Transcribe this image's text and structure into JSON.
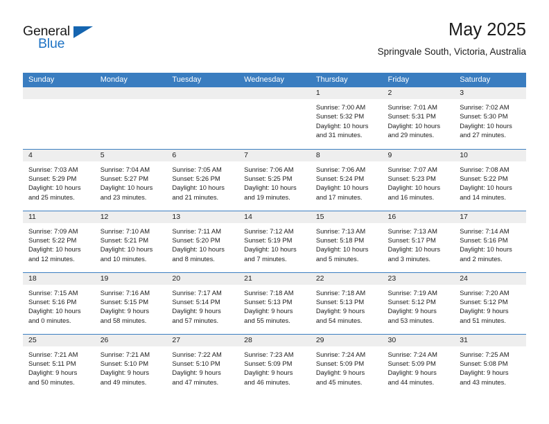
{
  "brand": {
    "word_one": "General",
    "word_two": "Blue",
    "logo_icon": "triangle-logo-icon"
  },
  "header": {
    "title": "May 2025",
    "subtitle": "Springvale South, Victoria, Australia"
  },
  "colors": {
    "header_blue": "#3a7dc0",
    "brand_blue": "#1e73c4",
    "daynum_strip": "#eeeeee",
    "text": "#1b1b1b"
  },
  "weekday_headers": [
    "Sunday",
    "Monday",
    "Tuesday",
    "Wednesday",
    "Thursday",
    "Friday",
    "Saturday"
  ],
  "weeks": [
    [
      {
        "day": "",
        "empty": true
      },
      {
        "day": "",
        "empty": true
      },
      {
        "day": "",
        "empty": true
      },
      {
        "day": "",
        "empty": true
      },
      {
        "day": "1",
        "sunrise": "Sunrise: 7:00 AM",
        "sunset": "Sunset: 5:32 PM",
        "daylight_line1": "Daylight: 10 hours",
        "daylight_line2": "and 31 minutes."
      },
      {
        "day": "2",
        "sunrise": "Sunrise: 7:01 AM",
        "sunset": "Sunset: 5:31 PM",
        "daylight_line1": "Daylight: 10 hours",
        "daylight_line2": "and 29 minutes."
      },
      {
        "day": "3",
        "sunrise": "Sunrise: 7:02 AM",
        "sunset": "Sunset: 5:30 PM",
        "daylight_line1": "Daylight: 10 hours",
        "daylight_line2": "and 27 minutes."
      }
    ],
    [
      {
        "day": "4",
        "sunrise": "Sunrise: 7:03 AM",
        "sunset": "Sunset: 5:29 PM",
        "daylight_line1": "Daylight: 10 hours",
        "daylight_line2": "and 25 minutes."
      },
      {
        "day": "5",
        "sunrise": "Sunrise: 7:04 AM",
        "sunset": "Sunset: 5:27 PM",
        "daylight_line1": "Daylight: 10 hours",
        "daylight_line2": "and 23 minutes."
      },
      {
        "day": "6",
        "sunrise": "Sunrise: 7:05 AM",
        "sunset": "Sunset: 5:26 PM",
        "daylight_line1": "Daylight: 10 hours",
        "daylight_line2": "and 21 minutes."
      },
      {
        "day": "7",
        "sunrise": "Sunrise: 7:06 AM",
        "sunset": "Sunset: 5:25 PM",
        "daylight_line1": "Daylight: 10 hours",
        "daylight_line2": "and 19 minutes."
      },
      {
        "day": "8",
        "sunrise": "Sunrise: 7:06 AM",
        "sunset": "Sunset: 5:24 PM",
        "daylight_line1": "Daylight: 10 hours",
        "daylight_line2": "and 17 minutes."
      },
      {
        "day": "9",
        "sunrise": "Sunrise: 7:07 AM",
        "sunset": "Sunset: 5:23 PM",
        "daylight_line1": "Daylight: 10 hours",
        "daylight_line2": "and 16 minutes."
      },
      {
        "day": "10",
        "sunrise": "Sunrise: 7:08 AM",
        "sunset": "Sunset: 5:22 PM",
        "daylight_line1": "Daylight: 10 hours",
        "daylight_line2": "and 14 minutes."
      }
    ],
    [
      {
        "day": "11",
        "sunrise": "Sunrise: 7:09 AM",
        "sunset": "Sunset: 5:22 PM",
        "daylight_line1": "Daylight: 10 hours",
        "daylight_line2": "and 12 minutes."
      },
      {
        "day": "12",
        "sunrise": "Sunrise: 7:10 AM",
        "sunset": "Sunset: 5:21 PM",
        "daylight_line1": "Daylight: 10 hours",
        "daylight_line2": "and 10 minutes."
      },
      {
        "day": "13",
        "sunrise": "Sunrise: 7:11 AM",
        "sunset": "Sunset: 5:20 PM",
        "daylight_line1": "Daylight: 10 hours",
        "daylight_line2": "and 8 minutes."
      },
      {
        "day": "14",
        "sunrise": "Sunrise: 7:12 AM",
        "sunset": "Sunset: 5:19 PM",
        "daylight_line1": "Daylight: 10 hours",
        "daylight_line2": "and 7 minutes."
      },
      {
        "day": "15",
        "sunrise": "Sunrise: 7:13 AM",
        "sunset": "Sunset: 5:18 PM",
        "daylight_line1": "Daylight: 10 hours",
        "daylight_line2": "and 5 minutes."
      },
      {
        "day": "16",
        "sunrise": "Sunrise: 7:13 AM",
        "sunset": "Sunset: 5:17 PM",
        "daylight_line1": "Daylight: 10 hours",
        "daylight_line2": "and 3 minutes."
      },
      {
        "day": "17",
        "sunrise": "Sunrise: 7:14 AM",
        "sunset": "Sunset: 5:16 PM",
        "daylight_line1": "Daylight: 10 hours",
        "daylight_line2": "and 2 minutes."
      }
    ],
    [
      {
        "day": "18",
        "sunrise": "Sunrise: 7:15 AM",
        "sunset": "Sunset: 5:16 PM",
        "daylight_line1": "Daylight: 10 hours",
        "daylight_line2": "and 0 minutes."
      },
      {
        "day": "19",
        "sunrise": "Sunrise: 7:16 AM",
        "sunset": "Sunset: 5:15 PM",
        "daylight_line1": "Daylight: 9 hours",
        "daylight_line2": "and 58 minutes."
      },
      {
        "day": "20",
        "sunrise": "Sunrise: 7:17 AM",
        "sunset": "Sunset: 5:14 PM",
        "daylight_line1": "Daylight: 9 hours",
        "daylight_line2": "and 57 minutes."
      },
      {
        "day": "21",
        "sunrise": "Sunrise: 7:18 AM",
        "sunset": "Sunset: 5:13 PM",
        "daylight_line1": "Daylight: 9 hours",
        "daylight_line2": "and 55 minutes."
      },
      {
        "day": "22",
        "sunrise": "Sunrise: 7:18 AM",
        "sunset": "Sunset: 5:13 PM",
        "daylight_line1": "Daylight: 9 hours",
        "daylight_line2": "and 54 minutes."
      },
      {
        "day": "23",
        "sunrise": "Sunrise: 7:19 AM",
        "sunset": "Sunset: 5:12 PM",
        "daylight_line1": "Daylight: 9 hours",
        "daylight_line2": "and 53 minutes."
      },
      {
        "day": "24",
        "sunrise": "Sunrise: 7:20 AM",
        "sunset": "Sunset: 5:12 PM",
        "daylight_line1": "Daylight: 9 hours",
        "daylight_line2": "and 51 minutes."
      }
    ],
    [
      {
        "day": "25",
        "sunrise": "Sunrise: 7:21 AM",
        "sunset": "Sunset: 5:11 PM",
        "daylight_line1": "Daylight: 9 hours",
        "daylight_line2": "and 50 minutes."
      },
      {
        "day": "26",
        "sunrise": "Sunrise: 7:21 AM",
        "sunset": "Sunset: 5:10 PM",
        "daylight_line1": "Daylight: 9 hours",
        "daylight_line2": "and 49 minutes."
      },
      {
        "day": "27",
        "sunrise": "Sunrise: 7:22 AM",
        "sunset": "Sunset: 5:10 PM",
        "daylight_line1": "Daylight: 9 hours",
        "daylight_line2": "and 47 minutes."
      },
      {
        "day": "28",
        "sunrise": "Sunrise: 7:23 AM",
        "sunset": "Sunset: 5:09 PM",
        "daylight_line1": "Daylight: 9 hours",
        "daylight_line2": "and 46 minutes."
      },
      {
        "day": "29",
        "sunrise": "Sunrise: 7:24 AM",
        "sunset": "Sunset: 5:09 PM",
        "daylight_line1": "Daylight: 9 hours",
        "daylight_line2": "and 45 minutes."
      },
      {
        "day": "30",
        "sunrise": "Sunrise: 7:24 AM",
        "sunset": "Sunset: 5:09 PM",
        "daylight_line1": "Daylight: 9 hours",
        "daylight_line2": "and 44 minutes."
      },
      {
        "day": "31",
        "sunrise": "Sunrise: 7:25 AM",
        "sunset": "Sunset: 5:08 PM",
        "daylight_line1": "Daylight: 9 hours",
        "daylight_line2": "and 43 minutes."
      }
    ]
  ]
}
